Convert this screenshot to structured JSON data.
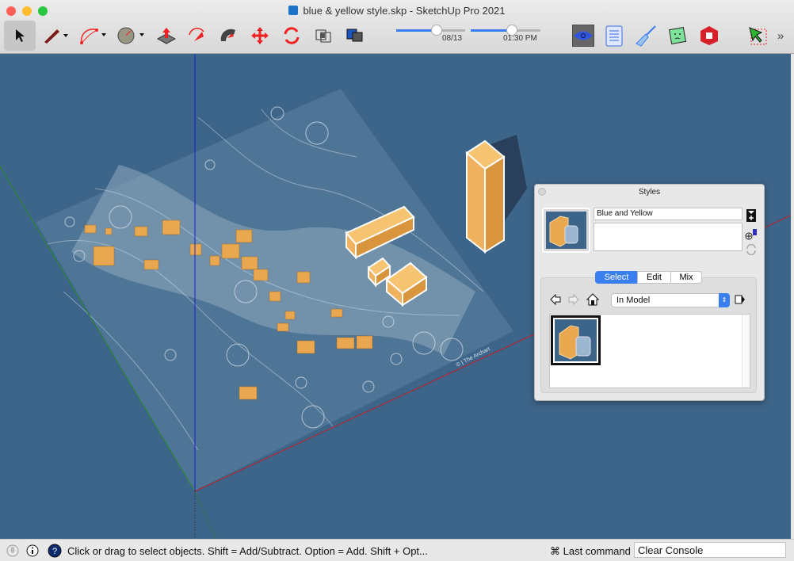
{
  "window": {
    "title": "blue & yellow style.skp - SketchUp Pro 2021"
  },
  "toolbar": {
    "tools": [
      "select-icon",
      "pencil-icon",
      "arc-icon",
      "circle-icon",
      "push-pull-icon",
      "follow-me-icon",
      "offset-icon",
      "move-icon",
      "rotate-icon",
      "section-plane-icon",
      "components-icon"
    ],
    "date_value": "08/13",
    "time_value": "01:30 PM",
    "date_progress": 0.76,
    "time_progress": 0.6,
    "right_tools": [
      "view-eye-icon",
      "notepad-icon",
      "cleanup-broom-icon",
      "face-icon",
      "extension-warehouse-icon",
      "select-region-icon"
    ],
    "overflow": "»"
  },
  "colors": {
    "viewport": "#3d6489",
    "accent": "#3a7ff0",
    "building": "#f2b65c"
  },
  "styles_panel": {
    "title": "Styles",
    "style_name": "Blue and Yellow",
    "description": "",
    "tabs": [
      {
        "label": "Select",
        "active": true
      },
      {
        "label": "Edit"
      },
      {
        "label": "Mix"
      }
    ],
    "collection": "In Model"
  },
  "plan": {
    "watermark": "© | The Archart"
  },
  "statusbar": {
    "hint": "Click or drag to select objects. Shift = Add/Subtract. Option = Add. Shift + Opt...",
    "last_command_label": "⌘ Last command",
    "last_command_value": "Clear Console"
  }
}
